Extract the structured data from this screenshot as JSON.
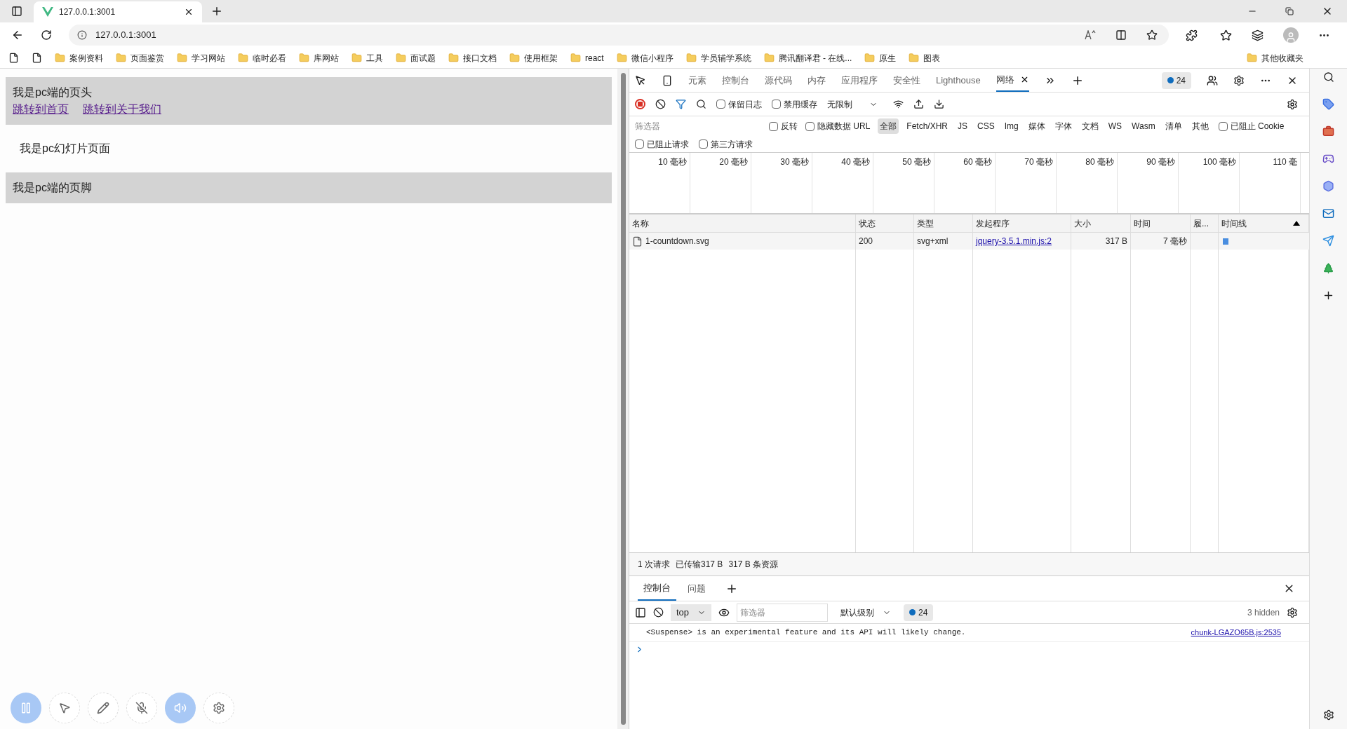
{
  "browser": {
    "tab_title": "127.0.0.1:3001",
    "address": "127.0.0.1:3001",
    "bookmarks": [
      "案例资料",
      "页面鉴赏",
      "学习网站",
      "临时必看",
      "库网站",
      "工具",
      "面试题",
      "接口文档",
      "使用框架",
      "react",
      "微信小程序",
      "学员辅学系统",
      "腾讯翻译君 - 在线...",
      "原生",
      "图表"
    ],
    "other_bookmarks": "其他收藏夹"
  },
  "page": {
    "header_title": "我是pc端的页头",
    "links": [
      "跳转到首页",
      "跳转到关于我们"
    ],
    "slide_text": "我是pc幻灯片页面",
    "footer_text": "我是pc端的页脚"
  },
  "media_controls": [
    {
      "kind": "pause",
      "on": true
    },
    {
      "kind": "pointer",
      "on": false
    },
    {
      "kind": "pen",
      "on": false
    },
    {
      "kind": "mic_off",
      "on": false
    },
    {
      "kind": "speaker",
      "on": true
    },
    {
      "kind": "settings",
      "on": false
    }
  ],
  "devtools": {
    "tabs": [
      {
        "label": "元素",
        "selected": false
      },
      {
        "label": "控制台",
        "selected": false
      },
      {
        "label": "源代码",
        "selected": false
      },
      {
        "label": "内存",
        "selected": false
      },
      {
        "label": "应用程序",
        "selected": false
      },
      {
        "label": "安全性",
        "selected": false
      },
      {
        "label": "Lighthouse",
        "selected": false
      },
      {
        "label": "网络",
        "selected": true
      }
    ],
    "issues_count": "24",
    "toolbar_checks": [
      {
        "label": "保留日志",
        "checked": false
      },
      {
        "label": "禁用缓存",
        "checked": false
      }
    ],
    "throttle": "无限制",
    "filter_placeholder": "筛选器",
    "filter_checks": [
      {
        "label": "反转",
        "checked": false
      },
      {
        "label": "隐藏数据 URL",
        "checked": false
      }
    ],
    "type_filters": [
      {
        "label": "全部",
        "selected": true
      },
      {
        "label": "Fetch/XHR",
        "selected": false
      },
      {
        "label": "JS",
        "selected": false
      },
      {
        "label": "CSS",
        "selected": false
      },
      {
        "label": "Img",
        "selected": false
      },
      {
        "label": "媒体",
        "selected": false
      },
      {
        "label": "字体",
        "selected": false
      },
      {
        "label": "文档",
        "selected": false
      },
      {
        "label": "WS",
        "selected": false
      },
      {
        "label": "Wasm",
        "selected": false
      },
      {
        "label": "清单",
        "selected": false
      },
      {
        "label": "其他",
        "selected": false
      }
    ],
    "blocked_cookies": {
      "label": "已阻止 Cookie",
      "checked": false
    },
    "second_row_checks": [
      {
        "label": "已阻止请求",
        "checked": false
      },
      {
        "label": "第三方请求",
        "checked": false
      }
    ],
    "timeline_ticks": [
      "10 毫秒",
      "20 毫秒",
      "30 毫秒",
      "40 毫秒",
      "50 毫秒",
      "60 毫秒",
      "70 毫秒",
      "80 毫秒",
      "90 毫秒",
      "100 毫秒",
      "110 毫"
    ],
    "table": {
      "columns": [
        "名称",
        "状态",
        "类型",
        "发起程序",
        "大小",
        "时间",
        "履...",
        "时间线"
      ],
      "rows": [
        {
          "name": "1-countdown.svg",
          "status": "200",
          "type": "svg+xml",
          "initiator": "jquery-3.5.1.min.js:2",
          "size": "317 B",
          "time": "7 毫秒"
        }
      ]
    },
    "summary": [
      "1 次请求",
      "已传输317 B",
      "317 B 条资源"
    ],
    "drawer": {
      "tabs": [
        {
          "label": "控制台",
          "selected": true
        },
        {
          "label": "问题",
          "selected": false
        }
      ],
      "context": "top",
      "filter_placeholder": "筛选器",
      "level": "默认级别",
      "issues_count": "24",
      "hidden": "3 hidden",
      "messages": [
        {
          "text": "<Suspense> is an experimental feature and its API will likely change.",
          "source": "chunk-LGAZO65B.js:2535"
        }
      ]
    }
  }
}
